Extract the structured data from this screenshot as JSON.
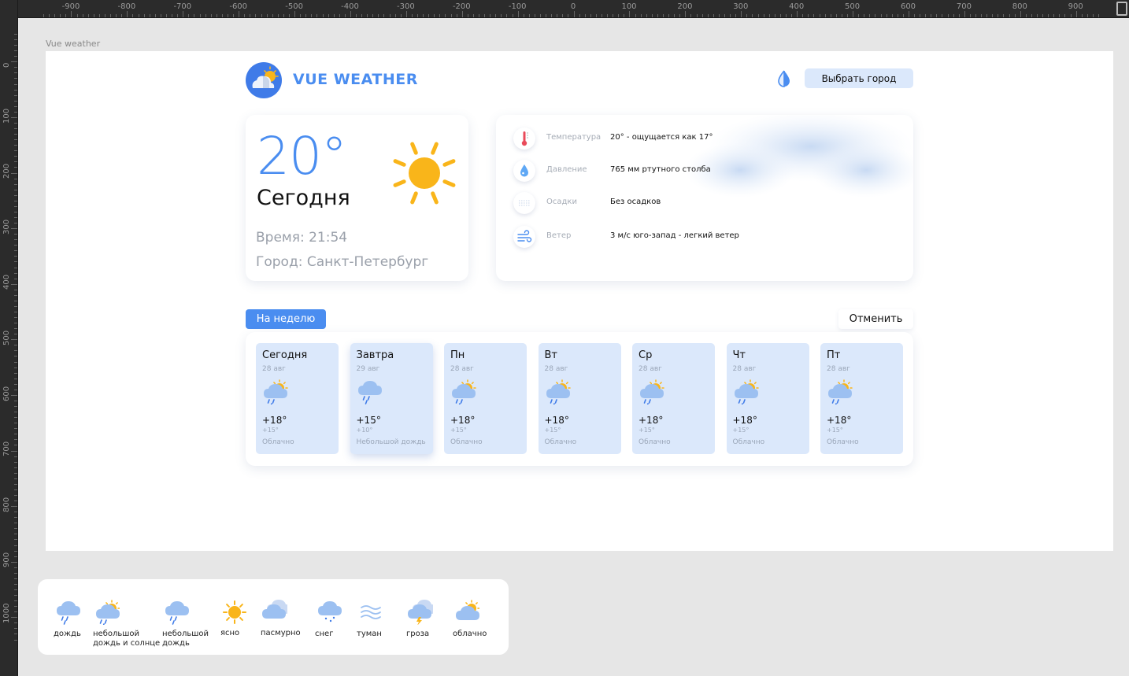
{
  "canvas": {
    "frame_label": "Vue weather",
    "ruler_top": [
      "-900",
      "-800",
      "-700",
      "-600",
      "-500",
      "-400",
      "-300",
      "-200",
      "-100",
      "0",
      "100",
      "200",
      "300",
      "400",
      "500",
      "600",
      "700",
      "800",
      "900"
    ],
    "ruler_left": [
      "0",
      "100",
      "200",
      "300",
      "400",
      "500",
      "600",
      "700",
      "800",
      "900",
      "1000"
    ]
  },
  "header": {
    "title": "VUE WEATHER",
    "logo_icon": "partly-cloudy-logo-icon",
    "theme_icon": "drop-icon",
    "city_button": "Выбрать город"
  },
  "today": {
    "temperature": "20°",
    "label": "Сегодня",
    "time": "Время: 21:54",
    "city": "Город: Санкт-Петербург",
    "icon": "sun-icon"
  },
  "details": {
    "rows": [
      {
        "icon": "thermometer-icon",
        "label": "Температура",
        "value": "20° - ощущается как 17°"
      },
      {
        "icon": "pressure-drop-icon",
        "label": "Давление",
        "value": "765 мм ртутного столба"
      },
      {
        "icon": "precipitation-icon",
        "label": "Осадки",
        "value": "Без осадков"
      },
      {
        "icon": "wind-icon",
        "label": "Ветер",
        "value": "3 м/с юго-запад - легкий ветер"
      }
    ]
  },
  "week": {
    "week_button": "На неделю",
    "cancel_button": "Отменить",
    "days": [
      {
        "name": "Сегодня",
        "date": "28 авг",
        "icon": "cloudy-rain-sun-icon",
        "temp": "+18°",
        "night": "+15°",
        "desc": "Облачно"
      },
      {
        "name": "Завтра",
        "date": "29 авг",
        "icon": "light-rain-icon",
        "temp": "+15°",
        "night": "+10°",
        "desc": "Небольшой дождь"
      },
      {
        "name": "Пн",
        "date": "28 авг",
        "icon": "cloudy-rain-sun-icon",
        "temp": "+18°",
        "night": "+15°",
        "desc": "Облачно"
      },
      {
        "name": "Вт",
        "date": "28 авг",
        "icon": "cloudy-rain-sun-icon",
        "temp": "+18°",
        "night": "+15°",
        "desc": "Облачно"
      },
      {
        "name": "Ср",
        "date": "28 авг",
        "icon": "cloudy-rain-sun-icon",
        "temp": "+18°",
        "night": "+15°",
        "desc": "Облачно"
      },
      {
        "name": "Чт",
        "date": "28 авг",
        "icon": "cloudy-rain-sun-icon",
        "temp": "+18°",
        "night": "+15°",
        "desc": "Облачно"
      },
      {
        "name": "Пт",
        "date": "28 авг",
        "icon": "cloudy-rain-sun-icon",
        "temp": "+18°",
        "night": "+15°",
        "desc": "Облачно"
      }
    ]
  },
  "legend": {
    "items": [
      {
        "icon": "rain-icon",
        "label": "дождь"
      },
      {
        "icon": "light-rain-sun-icon",
        "label": "небольшой\nдождь и солнце"
      },
      {
        "icon": "light-rain-icon",
        "label": "небольшой\nдождь"
      },
      {
        "icon": "clear-sun-icon",
        "label": "ясно"
      },
      {
        "icon": "overcast-icon",
        "label": "пасмурно"
      },
      {
        "icon": "snow-icon",
        "label": "снег"
      },
      {
        "icon": "fog-icon",
        "label": "туман"
      },
      {
        "icon": "thunderstorm-icon",
        "label": "гроза"
      },
      {
        "icon": "partly-cloudy-icon",
        "label": "облачно"
      }
    ]
  },
  "colors": {
    "accent": "#4a8df0",
    "card_tile": "#dbe8fb",
    "sun": "#f9b51a",
    "muted_text": "#9aa0aa"
  }
}
